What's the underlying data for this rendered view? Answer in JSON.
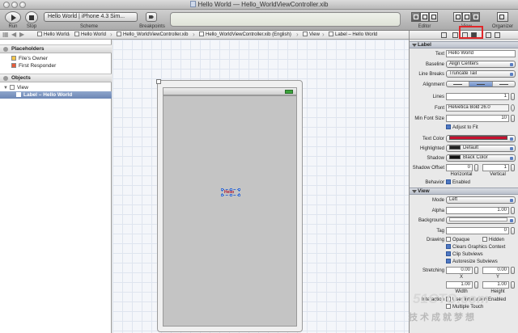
{
  "window": {
    "title": "Hello World — Hello_WorldViewController.xib"
  },
  "toolbar": {
    "run_label": "Run",
    "stop_label": "Stop",
    "scheme_label": "Scheme",
    "scheme_value": "Hello World | iPhone 4.3 Sim...",
    "breakpoints_label": "Breakpoints",
    "editor_label": "Editor",
    "view_label": "View",
    "organizer_label": "Organizer"
  },
  "jumpbar": {
    "items": [
      "Hello World",
      "Hello World",
      "Hello_WorldViewController.xib",
      "Hello_WorldViewController.xib (English)",
      "View",
      "Label – Hello World"
    ]
  },
  "navigator": {
    "placeholders_header": "Placeholders",
    "placeholders": [
      "File's Owner",
      "First Responder"
    ],
    "objects_header": "Objects",
    "view_item": "View",
    "label_item": "Label – Hello World"
  },
  "canvas": {
    "label_text": "Hello"
  },
  "inspector": {
    "label_section": "Label",
    "text_label": "Text",
    "text_value": "Hello World",
    "baseline_label": "Baseline",
    "baseline_value": "Align Centers",
    "line_breaks_label": "Line Breaks",
    "line_breaks_value": "Truncate Tail",
    "alignment_label": "Alignment",
    "lines_label": "Lines",
    "lines_value": "1",
    "font_label": "Font",
    "font_value": "Helvetica Bold 26.0",
    "min_font_label": "Min Font Size",
    "min_font_value": "10",
    "adjust_label": "Adjust to Fit",
    "text_color_label": "Text Color",
    "highlighted_label": "Highlighted",
    "highlighted_value": "Default",
    "shadow_label": "Shadow",
    "shadow_value": "Black Color",
    "shadow_offset_label": "Shadow Offset",
    "shadow_h_value": "0",
    "shadow_v_value": "1",
    "horizontal_label": "Horizontal",
    "vertical_label": "Vertical",
    "behavior_label": "Behavior",
    "enabled_label": "Enabled",
    "view_section": "View",
    "mode_label": "Mode",
    "mode_value": "Left",
    "alpha_label": "Alpha",
    "alpha_value": "1.00",
    "background_label": "Background",
    "tag_label": "Tag",
    "tag_value": "0",
    "drawing_label": "Drawing",
    "opaque_label": "Opaque",
    "hidden_label": "Hidden",
    "clears_label": "Clears Graphics Context",
    "clip_label": "Clip Subviews",
    "autoresize_label": "Autoresize Subviews",
    "stretching_label": "Stretching",
    "stretch_x_value": "0.00",
    "stretch_y_value": "0.00",
    "stretch_w_value": "1.00",
    "stretch_h_value": "1.00",
    "x_label": "X",
    "y_label": "Y",
    "width_label": "Width",
    "height_label": "Height",
    "interaction_label": "Interaction",
    "user_interaction_label": "User Interaction Enabled",
    "multiple_touch_label": "Multiple Touch"
  },
  "watermark": {
    "logo": "51CTO.com",
    "text": "技术成就梦想"
  },
  "colors": {
    "accent": "#e0282a",
    "selection": "#6c86b4",
    "text_color_swatch": "#c8102e"
  }
}
